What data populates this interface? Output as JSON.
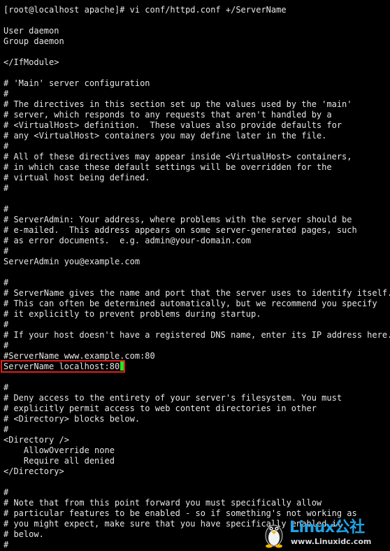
{
  "terminal": {
    "lines": [
      "[root@localhost apache]# vi conf/httpd.conf +/ServerName",
      "",
      "User daemon",
      "Group daemon",
      "",
      "</IfModule>",
      "",
      "# 'Main' server configuration",
      "#",
      "# The directives in this section set up the values used by the 'main'",
      "# server, which responds to any requests that aren't handled by a",
      "# <VirtualHost> definition.  These values also provide defaults for",
      "# any <VirtualHost> containers you may define later in the file.",
      "#",
      "# All of these directives may appear inside <VirtualHost> containers,",
      "# in which case these default settings will be overridden for the",
      "# virtual host being defined.",
      "#",
      "",
      "#",
      "# ServerAdmin: Your address, where problems with the server should be",
      "# e-mailed.  This address appears on some server-generated pages, such",
      "# as error documents.  e.g. admin@your-domain.com",
      "#",
      "ServerAdmin you@example.com",
      "",
      "#",
      "# ServerName gives the name and port that the server uses to identify itself.",
      "# This can often be determined automatically, but we recommend you specify",
      "# it explicitly to prevent problems during startup.",
      "#",
      "# If your host doesn't have a registered DNS name, enter its IP address here.",
      "#",
      "#ServerName www.example.com:80",
      "ServerName localhost:80",
      "",
      "#",
      "# Deny access to the entirety of your server's filesystem. You must",
      "# explicitly permit access to web content directories in other",
      "# <Directory> blocks below.",
      "#",
      "<Directory />",
      "    AllowOverride none",
      "    Require all denied",
      "</Directory>",
      "",
      "#",
      "# Note that from this point forward you must specifically allow",
      "# particular features to be enabled - so if something's not working as",
      "# you might expect, make sure that you have specifically enabled it",
      "# below.",
      "#"
    ],
    "highlighted_line_index": 34,
    "colors": {
      "background": "#000000",
      "text": "#e6e6e6",
      "cursor": "#22e822",
      "highlight_border": "#e01e1e"
    }
  },
  "watermark": {
    "brand": "Linux公社",
    "url": "www.Linuxidc.com",
    "icon": "tux-penguin-icon",
    "color": "#1fa3e6"
  }
}
